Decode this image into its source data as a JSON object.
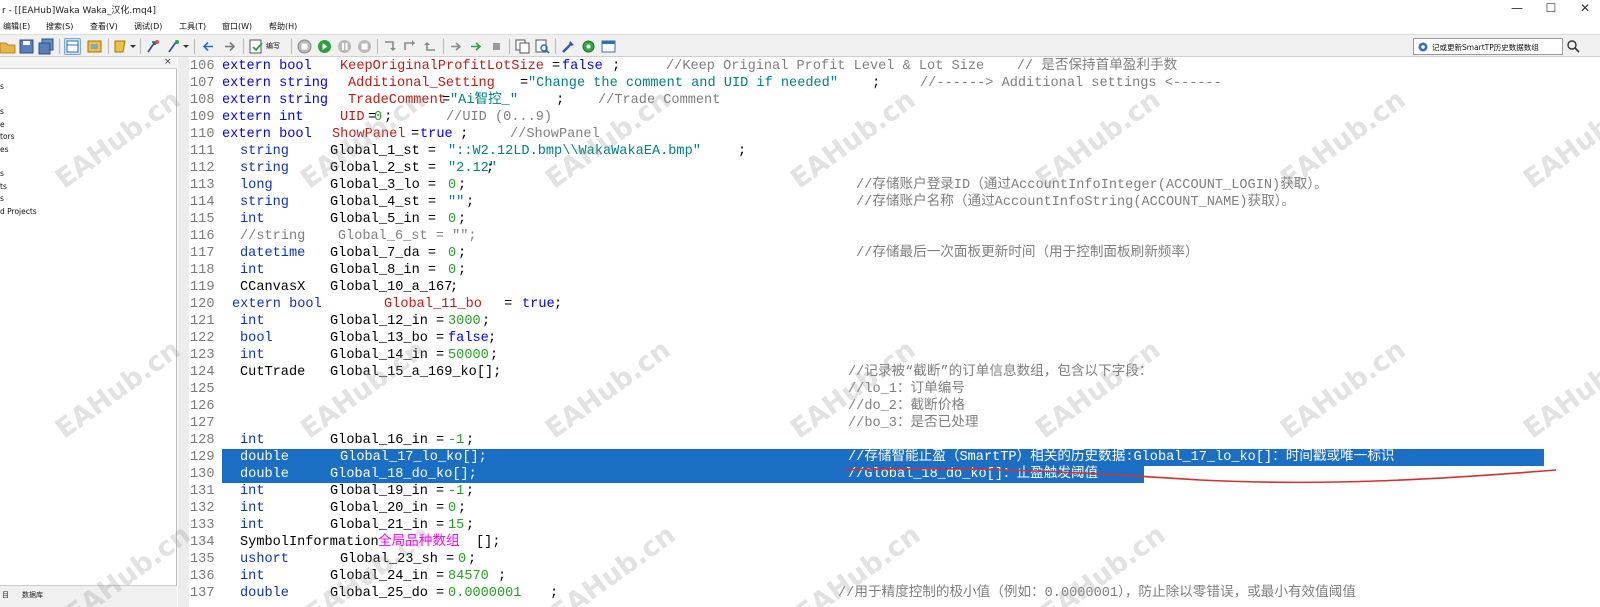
{
  "window": {
    "title": "r - [[EAHub]Waka Waka_汉化.mq4]",
    "controls": [
      "—",
      "☐",
      "✕"
    ]
  },
  "menu": [
    {
      "label": "编辑(E)"
    },
    {
      "label": "搜索(S)"
    },
    {
      "label": "查看(V)"
    },
    {
      "label": "调试(D)"
    },
    {
      "label": "工具(T)"
    },
    {
      "label": "窗口(W)"
    },
    {
      "label": "帮助(H)"
    }
  ],
  "toolbar": {
    "compile_label": "编写",
    "search_value": "记或更新SmartTP历史数据数组"
  },
  "navigator": {
    "close": "×",
    "items": [
      "s",
      "s",
      "e",
      "tors",
      "es",
      "s",
      "ts",
      "s",
      "d Projects"
    ],
    "bottom_tabs": [
      "目",
      "数据库"
    ]
  },
  "watermark": "EAHub.cn",
  "colors": {
    "selection": "#1a6fc4",
    "keyword": "#0000ff",
    "variable": "#c11b17",
    "string": "#008080",
    "number": "#2a9d2a",
    "comment": "#7f7f7f",
    "annotation": "#d43030"
  },
  "code_lines": [
    {
      "num": "106",
      "segs": [
        "extern bool ",
        "KeepOriginalProfitLotSize",
        "=",
        "false",
        " ;",
        "//Keep Original Profit Level & Lot Size    // 是否保持首单盈利手数"
      ]
    },
    {
      "num": "107",
      "segs": [
        "extern string ",
        "Additional_Setting",
        "=",
        "\"Change the comment and UID if needed\"",
        " ;",
        "//------> Additional settings <------"
      ]
    },
    {
      "num": "108",
      "segs": [
        "extern string ",
        "TradeComment",
        "=",
        "\"Ai智控_\"",
        " ;",
        "//Trade Comment"
      ]
    },
    {
      "num": "109",
      "segs": [
        "extern int   ",
        "UID",
        "=",
        "0",
        " ;",
        "//UID (0...9)"
      ]
    },
    {
      "num": "110",
      "segs": [
        "extern bool ",
        "ShowPanel",
        "=",
        "true",
        " ;",
        "//ShowPanel"
      ]
    },
    {
      "num": "111",
      "segs": [
        "string",
        "Global_1_st = ",
        "\"::W2.12LD.bmp\\\\WakaWakaEA.bmp\"",
        ";"
      ]
    },
    {
      "num": "112",
      "segs": [
        "string",
        "Global_2_st = ",
        "\"2.12\"",
        ";"
      ]
    },
    {
      "num": "113",
      "segs": [
        "long",
        "Global_3_lo = ",
        "0",
        ";",
        "//存储账户登录ID（通过AccountInfoInteger(ACCOUNT_LOGIN)获取）。"
      ]
    },
    {
      "num": "114",
      "segs": [
        "string",
        "Global_4_st = ",
        "\"\"",
        ";",
        "//存储账户名称（通过AccountInfoString(ACCOUNT_NAME)获取）。"
      ]
    },
    {
      "num": "115",
      "segs": [
        "int",
        "Global_5_in = ",
        "0",
        ";"
      ]
    },
    {
      "num": "116",
      "segs": [
        "//string    Global_6_st = \"\";"
      ]
    },
    {
      "num": "117",
      "segs": [
        "datetime",
        "Global_7_da = ",
        "0",
        ";",
        "//存储最后一次面板更新时间（用于控制面板刷新频率）"
      ]
    },
    {
      "num": "118",
      "segs": [
        "int",
        "Global_8_in = ",
        "0",
        ";"
      ]
    },
    {
      "num": "119",
      "segs": [
        "CCanvasX",
        "Global_10_a_167",
        ";"
      ]
    },
    {
      "num": "120",
      "segs": [
        "extern bool",
        "Global_11_bo",
        " = ",
        "true",
        ";"
      ]
    },
    {
      "num": "121",
      "segs": [
        "int",
        "Global_12_in = ",
        "3000",
        ";"
      ]
    },
    {
      "num": "122",
      "segs": [
        "bool",
        "Global_13_bo = ",
        "false",
        ";"
      ]
    },
    {
      "num": "123",
      "segs": [
        "int",
        "Global_14_in = ",
        "50000",
        ";"
      ]
    },
    {
      "num": "124",
      "segs": [
        "CutTrade",
        "Global_15_a_169_ko[];",
        "//记录被“截断”的订单信息数组，包含以下字段："
      ]
    },
    {
      "num": "125",
      "segs": [
        "//lo_1：订单编号"
      ]
    },
    {
      "num": "126",
      "segs": [
        "//do_2：截断价格"
      ]
    },
    {
      "num": "127",
      "segs": [
        "//bo_3：是否已处理"
      ]
    },
    {
      "num": "128",
      "segs": [
        "int",
        "Global_16_in = ",
        "-1",
        ";"
      ]
    },
    {
      "num": "129",
      "segs": [
        "double",
        "Global_17_lo_ko[];",
        "//存储智能止盈（SmartTP）相关的历史数据:Global_17_lo_ko[]：时间戳或唯一标识"
      ]
    },
    {
      "num": "130",
      "segs": [
        "double",
        "Global_18_do_ko[];",
        "//Global_18_do_ko[]：止盈触发阈值"
      ]
    },
    {
      "num": "131",
      "segs": [
        "int",
        "Global_19_in = ",
        "-1",
        ";"
      ]
    },
    {
      "num": "132",
      "segs": [
        "int",
        "Global_20_in = ",
        "0",
        ";"
      ]
    },
    {
      "num": "133",
      "segs": [
        "int",
        "Global_21_in = ",
        "15",
        ";"
      ]
    },
    {
      "num": "134",
      "segs": [
        "SymbolInformation ",
        "全局品种数组",
        "[];"
      ]
    },
    {
      "num": "135",
      "segs": [
        "ushort",
        "Global_23_sh = ",
        "0",
        ";"
      ]
    },
    {
      "num": "136",
      "segs": [
        "int",
        "Global_24_in = ",
        "84570",
        ";"
      ]
    },
    {
      "num": "137",
      "segs": [
        "double",
        "Global_25_do = ",
        "0.0000001",
        ";",
        "//用于精度控制的极小值（例如：0.0000001），防止除以零错误，或最小有效值阈值"
      ]
    }
  ]
}
